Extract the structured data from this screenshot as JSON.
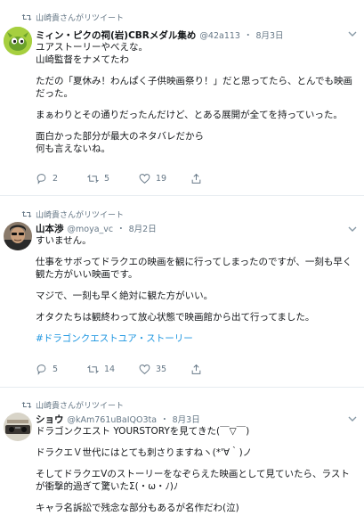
{
  "tweets": [
    {
      "retweeted_by": "山崎貴さんがリツイート",
      "name": "ミィン・ピクの祠(岩)CBRメダル集め",
      "handle": "@42a113",
      "dot": "・",
      "date": "8月3日",
      "lines": [
        "ユアストーリーやべえな。",
        "山崎監督をナメてたわ",
        "",
        "ただの「夏休み！わんぱく子供映画祭り！」だと思ってたら、とんでも映画",
        "だった。",
        "",
        "まぁわりとその通りだったんだけど、とある展開が全てを持っていった。",
        "",
        "面白かった部分が最大のネタバレだから",
        "何も言えないね。"
      ],
      "hashtag": "",
      "replies": "2",
      "retweets": "5",
      "likes": "19"
    },
    {
      "retweeted_by": "山崎貴さんがリツイート",
      "name": "山本渉",
      "handle": "@moya_vc",
      "dot": "・",
      "date": "8月2日",
      "lines": [
        "すいません。",
        "",
        "仕事をサボってドラクエの映画を観に行ってしまったのですが、一刻も早く",
        "観た方がいい映画です。",
        "",
        "マジで、一刻も早く絶対に観た方がいい。",
        "",
        "オタクたちは観終わって放心状態で映画館から出て行ってました。",
        ""
      ],
      "hashtag": "#ドラゴンクエストユア・ストーリー",
      "replies": "5",
      "retweets": "14",
      "likes": "35"
    },
    {
      "retweeted_by": "山崎貴さんがリツイート",
      "name": "ショウ",
      "handle": "@kAm761uBaIQO3ta",
      "dot": "・",
      "date": "8月3日",
      "lines": [
        "ドラゴンクエスト YOURSTORYを見てきた(￣▽￣)",
        "",
        "ドラクエＶ世代にはとても刺さりますねヽ(*'∀｀)ノ",
        "",
        "そしてドラクエVのストーリーをなぞらえた映画として見ていたら、ラスト",
        "が衝撃的過ぎて驚いたΣ(・ω・ﾉ)ﾉ",
        "",
        "キャラ名訴訟で残念な部分もあるが名作だわ(泣)"
      ],
      "hashtag": "",
      "replies": "",
      "retweets": "",
      "likes": ""
    }
  ],
  "colors": {
    "text": "#14171a",
    "muted": "#657786",
    "link": "#1b95e0",
    "border": "#e6ecf0"
  },
  "icons": [
    "retweet-icon",
    "chevron-down-icon",
    "reply-icon",
    "like-icon",
    "share-icon"
  ]
}
